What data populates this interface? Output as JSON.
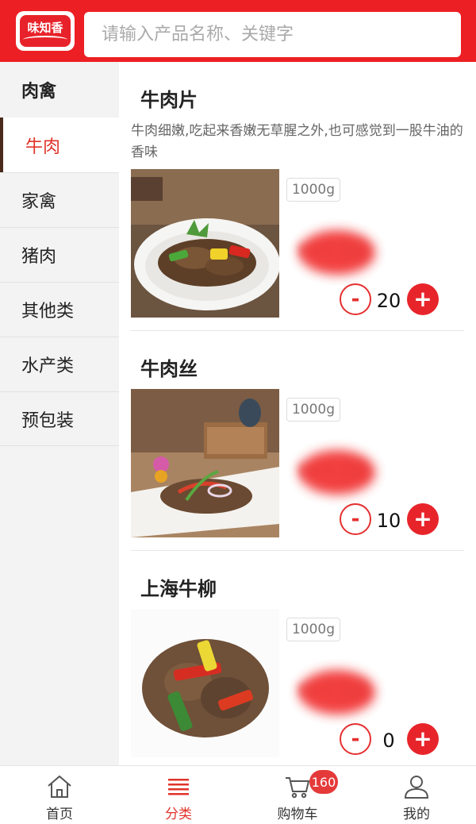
{
  "header": {
    "logo_text": "味知香",
    "search_placeholder": "请输入产品名称、关键字"
  },
  "sidebar": {
    "category_title": "肉禽",
    "items": [
      {
        "label": "牛肉",
        "active": true
      },
      {
        "label": "家禽",
        "active": false
      },
      {
        "label": "猪肉",
        "active": false
      },
      {
        "label": "其他类",
        "active": false
      },
      {
        "label": "水产类",
        "active": false
      },
      {
        "label": "预包装",
        "active": false
      }
    ]
  },
  "products": [
    {
      "title": "牛肉片",
      "description": "牛肉细嫩,吃起来香嫩无草腥之外,也可感觉到一股牛油的香味",
      "weight": "1000g",
      "price": "¥••.60",
      "quantity": "20",
      "minus_label": "-",
      "plus_label": "+"
    },
    {
      "title": "牛肉丝",
      "weight": "1000g",
      "price": "¥••.00",
      "quantity": "10",
      "minus_label": "-",
      "plus_label": "+"
    },
    {
      "title": "上海牛柳",
      "weight": "1000g",
      "price": "¥••.60",
      "quantity": "0",
      "minus_label": "-",
      "plus_label": "+"
    }
  ],
  "tabbar": {
    "items": [
      {
        "label": "首页",
        "icon": "home-icon",
        "active": false
      },
      {
        "label": "分类",
        "icon": "category-list-icon",
        "active": true
      },
      {
        "label": "购物车",
        "icon": "cart-icon",
        "active": false
      },
      {
        "label": "我的",
        "icon": "user-icon",
        "active": false
      }
    ],
    "cart_badge": "160"
  },
  "colors": {
    "brand_red": "#ec1f24",
    "active_text": "#e0332a",
    "sidebar_bg": "#f3f3f3"
  }
}
